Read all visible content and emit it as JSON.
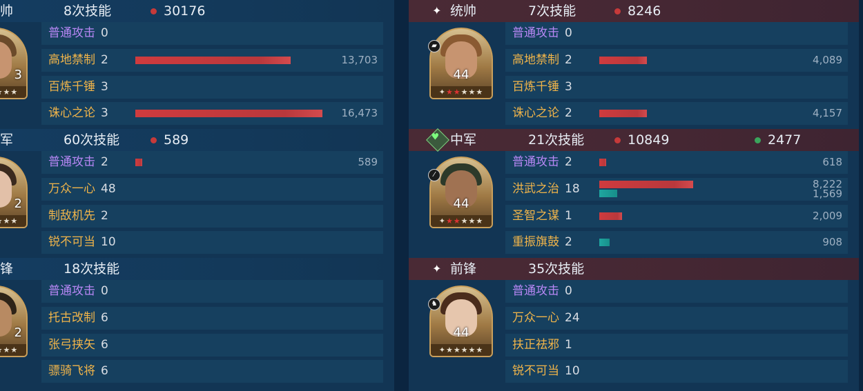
{
  "colors": {
    "damage": "#c63a3a",
    "heal": "#3aa55c",
    "skill_name": "#f0b44a",
    "normal_attack": "#b887f5"
  },
  "left": {
    "sections": [
      {
        "role": "帅",
        "skill_count": "8次技能",
        "damage": "30176",
        "level": "3",
        "skills": [
          {
            "name": "普通攻击",
            "count": "0",
            "normal": true
          },
          {
            "name": "高地禁制",
            "count": "2",
            "damage_value": "13,703",
            "damage_fraction": 0.83
          },
          {
            "name": "百炼千锤",
            "count": "3"
          },
          {
            "name": "诛心之论",
            "count": "3",
            "damage_value": "16,473",
            "damage_fraction": 1.0
          }
        ]
      },
      {
        "role": "军",
        "skill_count": "60次技能",
        "damage": "589",
        "level": "2",
        "skills": [
          {
            "name": "普通攻击",
            "count": "2",
            "normal": true,
            "damage_value": "589",
            "damage_fraction": 0.036
          },
          {
            "name": "万众一心",
            "count": "48"
          },
          {
            "name": "制敌机先",
            "count": "2"
          },
          {
            "name": "锐不可当",
            "count": "10"
          }
        ]
      },
      {
        "role": "锋",
        "skill_count": "18次技能",
        "level": "2",
        "skills": [
          {
            "name": "普通攻击",
            "count": "0",
            "normal": true
          },
          {
            "name": "托古改制",
            "count": "6"
          },
          {
            "name": "张弓挟矢",
            "count": "6"
          },
          {
            "name": "骠骑飞将",
            "count": "6"
          }
        ]
      }
    ]
  },
  "right": {
    "sections": [
      {
        "role_icon": "✦",
        "role": "统帅",
        "skill_count": "7次技能",
        "damage": "8246",
        "level": "44",
        "badge_icon": "tank-icon",
        "skills": [
          {
            "name": "普通攻击",
            "count": "0",
            "normal": true
          },
          {
            "name": "高地禁制",
            "count": "2",
            "damage_value": "4,089",
            "damage_fraction": 0.26
          },
          {
            "name": "百炼千锤",
            "count": "3"
          },
          {
            "name": "诛心之论",
            "count": "2",
            "damage_value": "4,157",
            "damage_fraction": 0.26
          }
        ]
      },
      {
        "role_icon": "heart-icon",
        "role": "中军",
        "skill_count": "21次技能",
        "damage": "10849",
        "heal": "2477",
        "level": "44",
        "badge_icon": "slash-icon",
        "skills": [
          {
            "name": "普通攻击",
            "count": "2",
            "normal": true,
            "damage_value": "618",
            "damage_fraction": 0.037
          },
          {
            "name": "洪武之治",
            "count": "18",
            "damage_value": "8,222",
            "damage_fraction": 0.5,
            "heal_value": "1,569",
            "heal_fraction": 0.095
          },
          {
            "name": "圣智之谋",
            "count": "1",
            "damage_value": "2,009",
            "damage_fraction": 0.122
          },
          {
            "name": "重振旗鼓",
            "count": "2",
            "heal_value": "908",
            "heal_fraction": 0.055
          }
        ]
      },
      {
        "role_icon": "✦",
        "role": "前锋",
        "skill_count": "35次技能",
        "level": "44",
        "badge_icon": "horse-icon",
        "skills": [
          {
            "name": "普通攻击",
            "count": "0",
            "normal": true
          },
          {
            "name": "万众一心",
            "count": "24"
          },
          {
            "name": "扶正祛邪",
            "count": "1"
          },
          {
            "name": "锐不可当",
            "count": "10"
          }
        ]
      }
    ]
  }
}
